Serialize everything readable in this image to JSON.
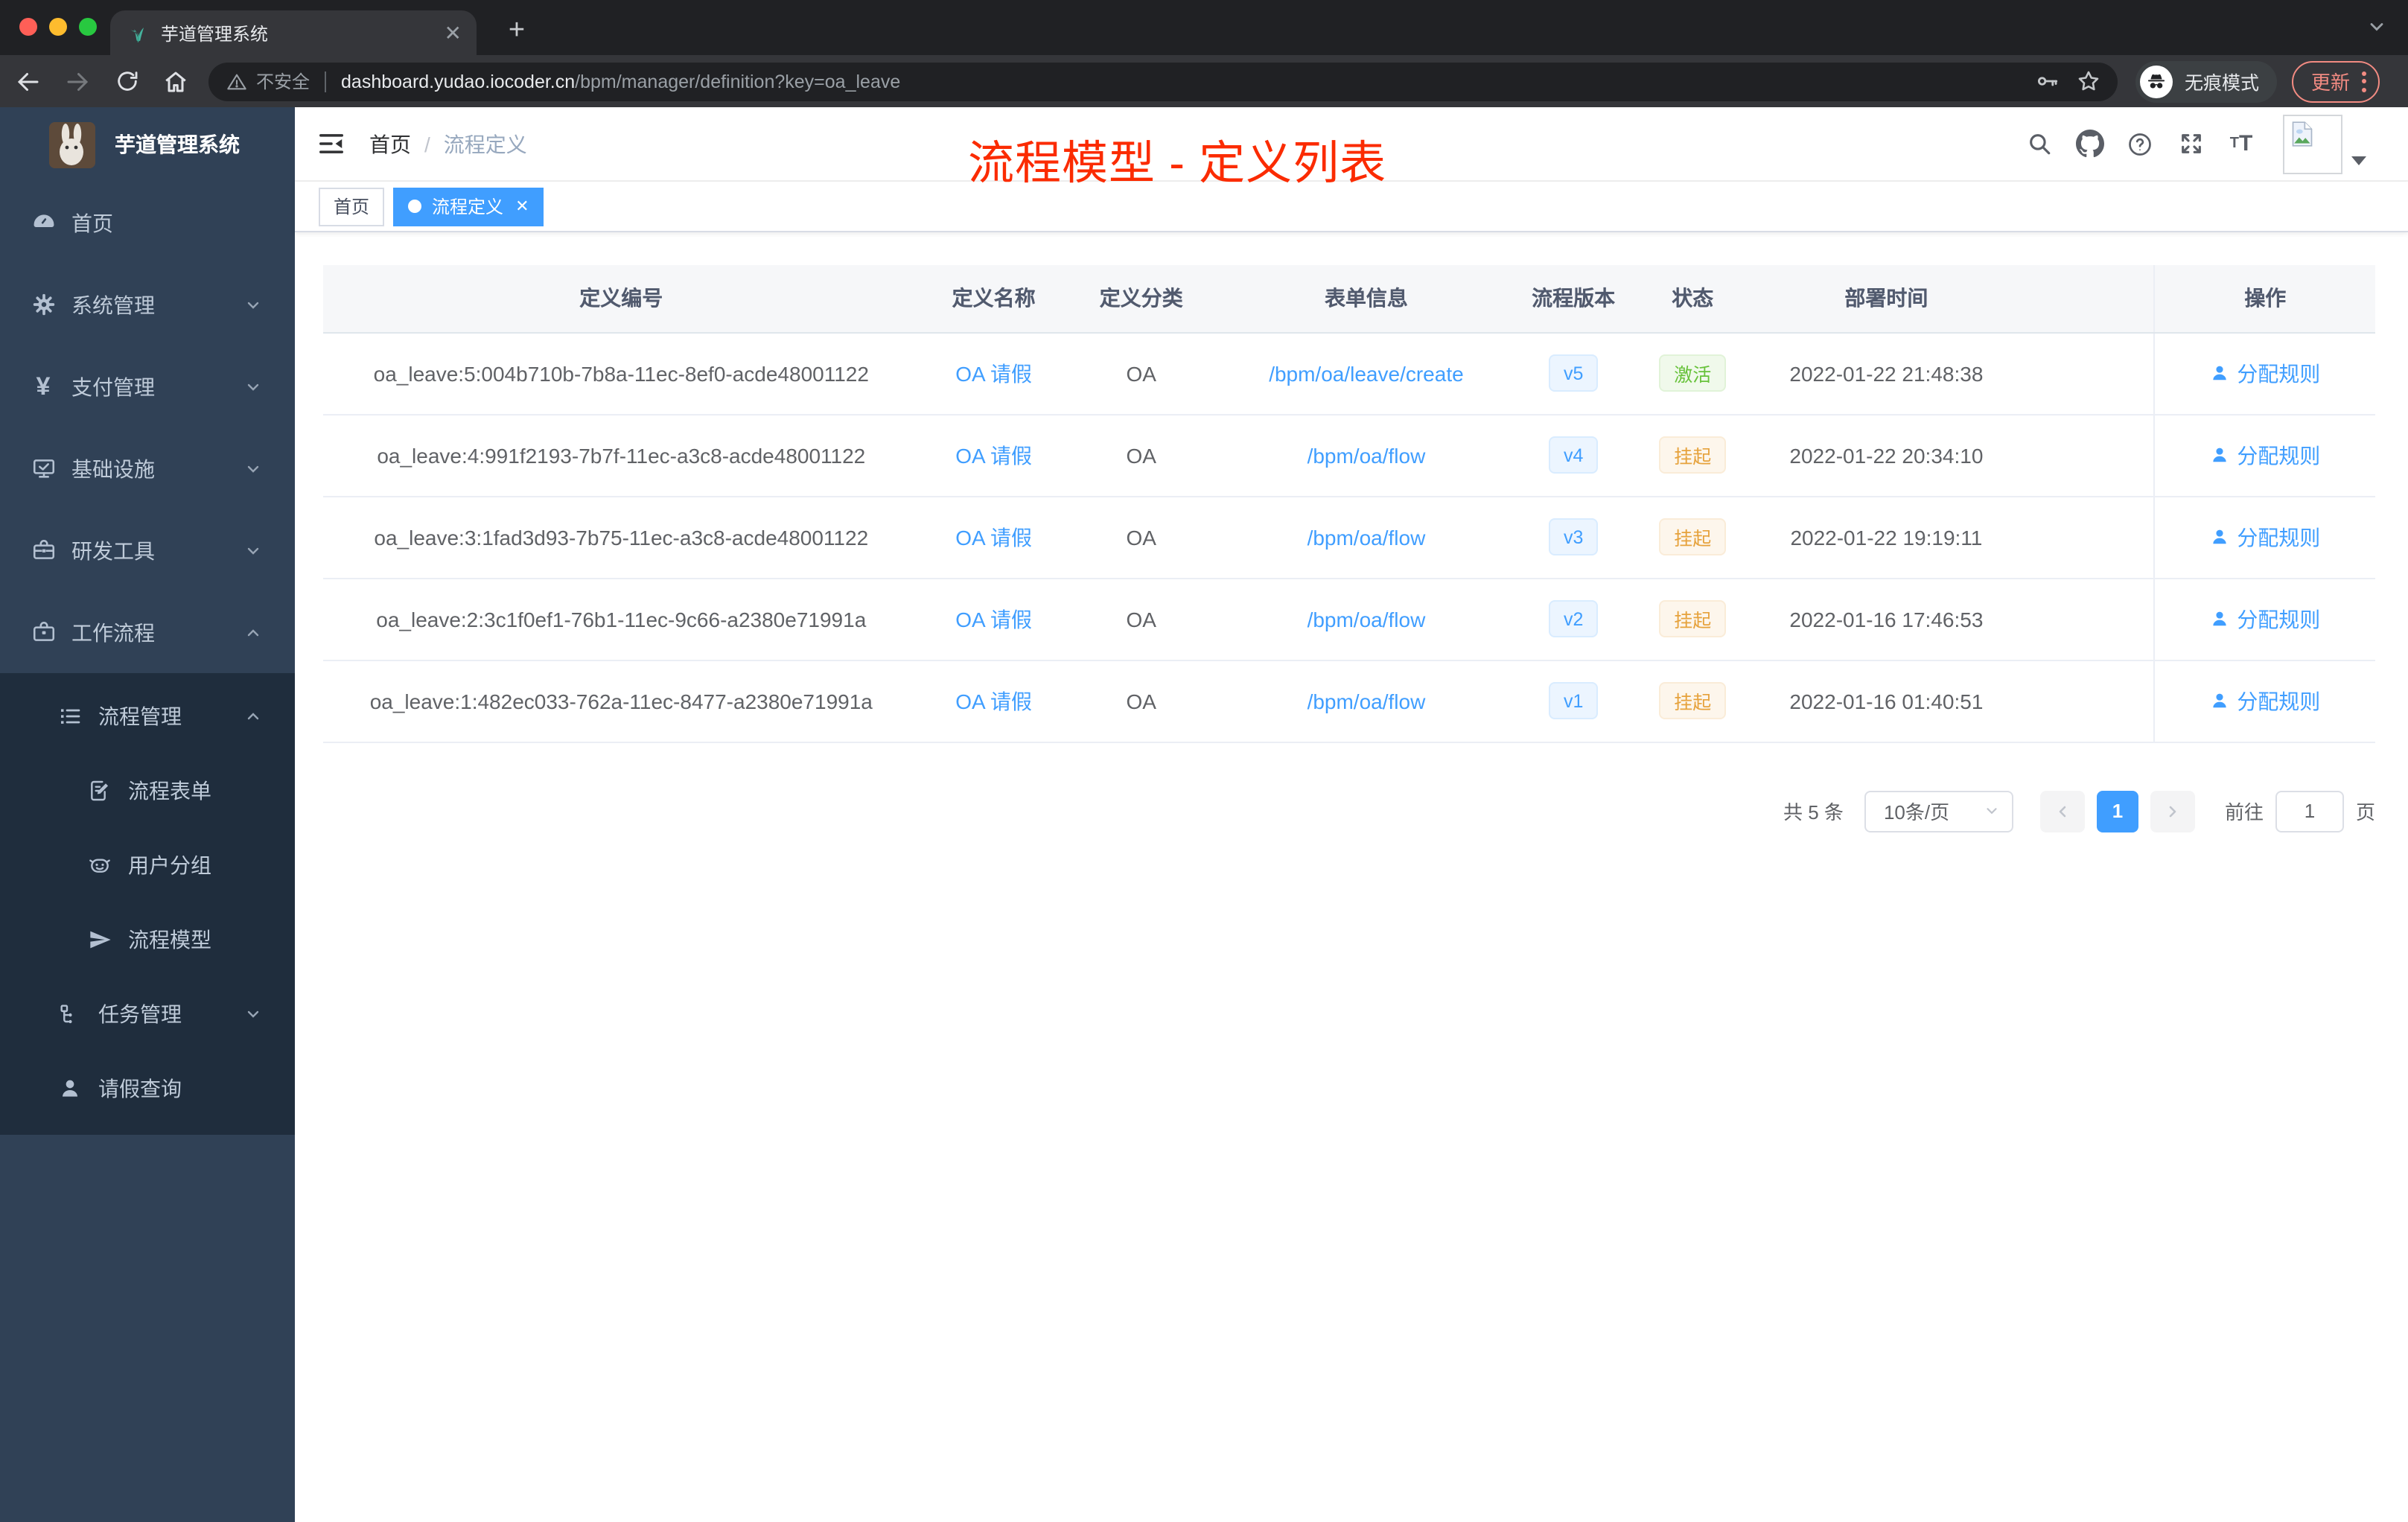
{
  "colors": {
    "accent": "#409eff",
    "success": "#67c23a",
    "warning": "#e6a23c",
    "annotation_red": "#fb2b00",
    "sidebar_bg": "#304156",
    "submenu_bg": "#1f2d3d",
    "chrome_dark": "#202124",
    "toolbar_dark": "#35363a"
  },
  "browser": {
    "tab_title": "芋道管理系统",
    "security_label": "不安全",
    "url_domain": "dashboard.yudao.iocoder.cn",
    "url_path": "/bpm/manager/definition?key=oa_leave",
    "incognito_label": "无痕模式",
    "update_label": "更新"
  },
  "sidebar": {
    "title": "芋道管理系统",
    "menu": [
      {
        "label": "首页"
      },
      {
        "label": "系统管理"
      },
      {
        "label": "支付管理"
      },
      {
        "label": "基础设施"
      },
      {
        "label": "研发工具"
      },
      {
        "label": "工作流程"
      }
    ],
    "submenu": [
      {
        "label": "流程管理"
      },
      {
        "label": "流程表单"
      },
      {
        "label": "用户分组"
      },
      {
        "label": "流程模型"
      },
      {
        "label": "任务管理"
      },
      {
        "label": "请假查询"
      }
    ]
  },
  "header": {
    "breadcrumb": [
      "首页",
      "流程定义"
    ],
    "separator": "/"
  },
  "annotation": {
    "text": "流程模型 - 定义列表"
  },
  "tags": [
    {
      "label": "首页"
    },
    {
      "label": "流程定义"
    }
  ],
  "table": {
    "columns": [
      "定义编号",
      "定义名称",
      "定义分类",
      "表单信息",
      "流程版本",
      "状态",
      "部署时间",
      "操作"
    ],
    "rows": [
      {
        "id": "oa_leave:5:004b710b-7b8a-11ec-8ef0-acde48001122",
        "name": "OA 请假",
        "category": "OA",
        "form": "/bpm/oa/leave/create",
        "version": "v5",
        "status": "激活",
        "time": "2022-01-22 21:48:38",
        "action": "分配规则"
      },
      {
        "id": "oa_leave:4:991f2193-7b7f-11ec-a3c8-acde48001122",
        "name": "OA 请假",
        "category": "OA",
        "form": "/bpm/oa/flow",
        "version": "v4",
        "status": "挂起",
        "time": "2022-01-22 20:34:10",
        "action": "分配规则"
      },
      {
        "id": "oa_leave:3:1fad3d93-7b75-11ec-a3c8-acde48001122",
        "name": "OA 请假",
        "category": "OA",
        "form": "/bpm/oa/flow",
        "version": "v3",
        "status": "挂起",
        "time": "2022-01-22 19:19:11",
        "action": "分配规则"
      },
      {
        "id": "oa_leave:2:3c1f0ef1-76b1-11ec-9c66-a2380e71991a",
        "name": "OA 请假",
        "category": "OA",
        "form": "/bpm/oa/flow",
        "version": "v2",
        "status": "挂起",
        "time": "2022-01-16 17:46:53",
        "action": "分配规则"
      },
      {
        "id": "oa_leave:1:482ec033-762a-11ec-8477-a2380e71991a",
        "name": "OA 请假",
        "category": "OA",
        "form": "/bpm/oa/flow",
        "version": "v1",
        "status": "挂起",
        "time": "2022-01-16 01:40:51",
        "action": "分配规则"
      }
    ]
  },
  "pagination": {
    "total": "共 5 条",
    "page_size": "10条/页",
    "page": "1",
    "goto_label": "前往",
    "goto_value": "1",
    "goto_unit": "页"
  }
}
